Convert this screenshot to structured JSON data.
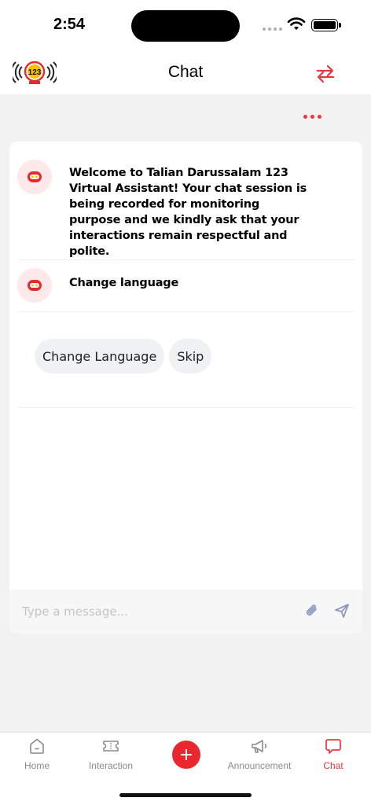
{
  "status_bar": {
    "time": "2:54"
  },
  "header": {
    "title": "Chat",
    "logo_text": "123"
  },
  "messages": [
    {
      "text": "Welcome to Talian Darussalam 123 Virtual Assistant! Your chat session is being recorded for monitoring purpose and we kindly ask that your interactions remain respectful and polite."
    },
    {
      "text": "Change language"
    }
  ],
  "quick_replies": [
    {
      "label": "Change Language"
    },
    {
      "label": "Skip"
    }
  ],
  "composer": {
    "placeholder": "Type a message..."
  },
  "tabs": [
    {
      "label": "Home",
      "icon": "home-icon",
      "active": false
    },
    {
      "label": "Interaction",
      "icon": "ticket-icon",
      "active": false
    },
    {
      "label": "",
      "icon": "plus-icon",
      "active": false
    },
    {
      "label": "Announcement",
      "icon": "megaphone-icon",
      "active": false
    },
    {
      "label": "Chat",
      "icon": "chat-bubble-icon",
      "active": true
    }
  ],
  "colors": {
    "accent": "#e8383d",
    "background": "#f2f2f2",
    "avatar_bg": "#fde8ea"
  }
}
